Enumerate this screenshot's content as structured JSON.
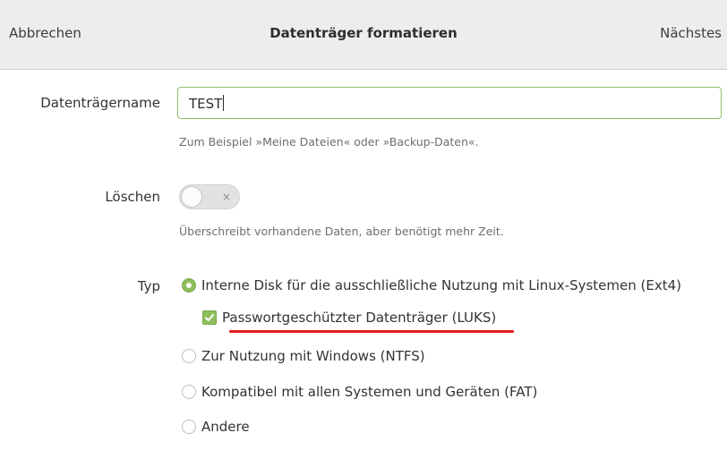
{
  "header": {
    "cancel_label": "Abbrechen",
    "title": "Datenträger formatieren",
    "next_label": "Nächstes"
  },
  "name_field": {
    "label": "Datenträgername",
    "value": "TEST",
    "hint": "Zum Beispiel »Meine Dateien« oder »Backup-Daten«."
  },
  "erase": {
    "label": "Löschen",
    "enabled": false,
    "switch_glyph": "×",
    "hint": "Überschreibt vorhandene Daten, aber benötigt mehr Zeit."
  },
  "type": {
    "label": "Typ",
    "options": [
      {
        "label": "Interne Disk für die ausschließliche Nutzung mit Linux-Systemen (Ext4)",
        "selected": true
      },
      {
        "label": "Zur Nutzung mit Windows (NTFS)",
        "selected": false
      },
      {
        "label": "Kompatibel mit allen Systemen und Geräten (FAT)",
        "selected": false
      },
      {
        "label": "Andere",
        "selected": false
      }
    ],
    "luks": {
      "label": "Passwortgeschützter Datenträger (LUKS)",
      "checked": true
    }
  },
  "colors": {
    "accent_green": "#8fbe5c",
    "annotation_red": "#e31f1f"
  },
  "icons": {
    "radio_selected": "radio-selected-icon",
    "checkbox_checked": "checkmark-icon",
    "switch_off": "close-icon"
  }
}
